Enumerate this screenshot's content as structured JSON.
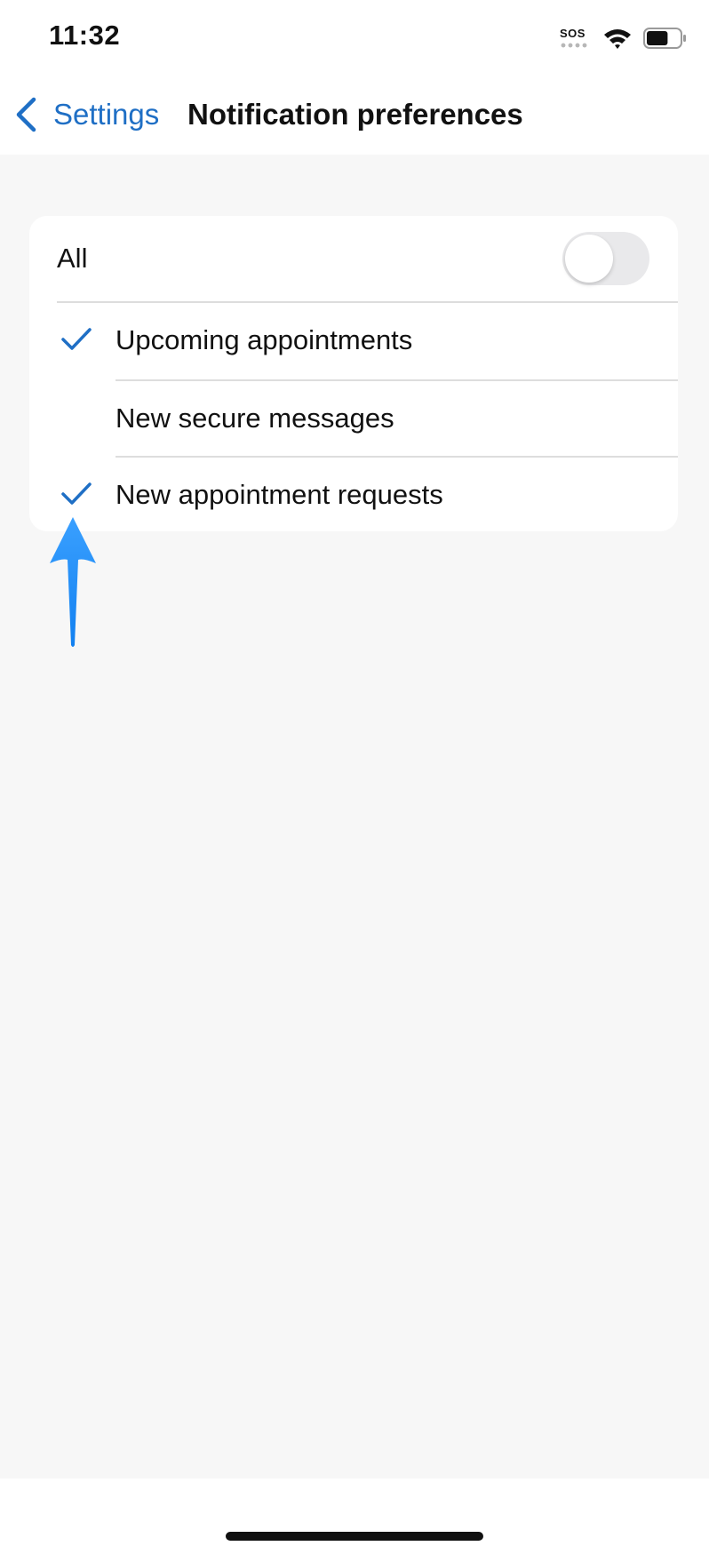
{
  "status_bar": {
    "time": "11:32",
    "sos_label": "SOS",
    "icons": [
      "sos-icon",
      "wifi-icon",
      "battery-icon"
    ],
    "battery_level": 0.65
  },
  "nav": {
    "back_label": "Settings",
    "title": "Notification preferences"
  },
  "preferences": {
    "all": {
      "label": "All",
      "toggle_on": false
    },
    "options": [
      {
        "label": "Upcoming appointments",
        "checked": true
      },
      {
        "label": "New secure messages",
        "checked": false
      },
      {
        "label": "New appointment requests",
        "checked": true
      }
    ]
  },
  "colors": {
    "accent": "#1f6fc5",
    "arrow": "#1e90ff",
    "background": "#f7f7f7",
    "card": "#ffffff",
    "toggle_off": "#e9e9eb"
  }
}
